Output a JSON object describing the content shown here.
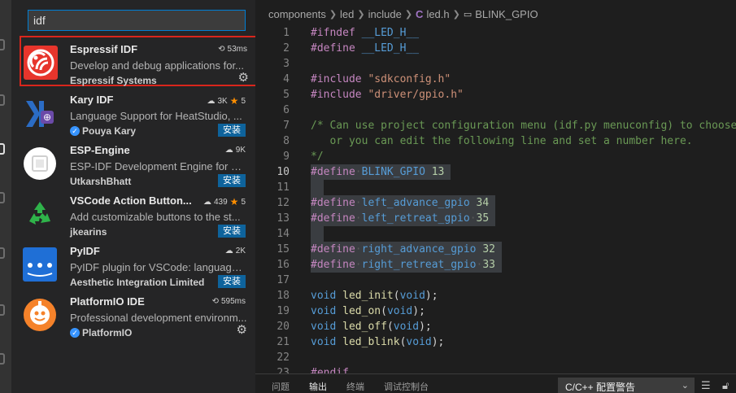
{
  "search": {
    "value": "idf"
  },
  "extensions": [
    {
      "name": "Espressif IDF",
      "description": "Develop and debug applications for...",
      "publisher": "Espressif Systems",
      "verified": false,
      "meta": "53ms",
      "meta_icon": "history-icon",
      "installed": true,
      "action": "gear",
      "selected": true
    },
    {
      "name": "Kary IDF",
      "description": "Language Support for HeatStudio, ...",
      "publisher": "Pouya Kary",
      "verified": true,
      "meta": "3K",
      "rating": "5",
      "installed": false,
      "action_label": "安装"
    },
    {
      "name": "ESP-Engine",
      "description": "ESP-IDF Development Engine for Mi...",
      "publisher": "UtkarshBhatt",
      "verified": false,
      "meta": "9K",
      "installed": false,
      "action_label": "安装"
    },
    {
      "name": "VSCode Action Button...",
      "description": "Add customizable buttons to the st...",
      "publisher": "jkearins",
      "verified": false,
      "meta": "439",
      "rating": "5",
      "installed": false,
      "action_label": "安装"
    },
    {
      "name": "PyIDF",
      "description": "PyIDF plugin for VSCode: language ...",
      "publisher": "Aesthetic Integration Limited",
      "verified": false,
      "meta": "2K",
      "installed": false,
      "action_label": "安装"
    },
    {
      "name": "PlatformIO IDE",
      "description": "Professional development environm...",
      "publisher": "PlatformIO",
      "verified": true,
      "meta": "595ms",
      "meta_icon": "history-icon",
      "installed": true,
      "action": "gear"
    }
  ],
  "breadcrumb": [
    "components",
    "led",
    "include",
    "led.h",
    "BLINK_GPIO"
  ],
  "code": {
    "line_numbers": [
      "1",
      "2",
      "3",
      "4",
      "5",
      "6",
      "7",
      "8",
      "9",
      "10",
      "11",
      "12",
      "13",
      "14",
      "15",
      "16",
      "17",
      "18",
      "19",
      "20",
      "21",
      "22",
      "23"
    ],
    "active_line": "10",
    "lines": {
      "l1_kw": "#ifndef",
      "l1_mac": "__LED_H__",
      "l2_kw": "#define",
      "l2_mac": "__LED_H__",
      "l4_kw": "#include",
      "l4_str": "\"sdkconfig.h\"",
      "l5_kw": "#include",
      "l5_str": "\"driver/gpio.h\"",
      "l7_cm": "/* Can use project configuration menu (idf.py menuconfig) to choose",
      "l8_cm": "   or you can edit the following line and set a number here.",
      "l9_cm": "*/",
      "l10_kw": "#define",
      "l10_mac": "BLINK_GPIO",
      "l10_num": "13",
      "l12_kw": "#define",
      "l12_mac": "left_advance_gpio",
      "l12_num": "34",
      "l13_kw": "#define",
      "l13_mac": "left_retreat_gpio",
      "l13_num": "35",
      "l15_kw": "#define",
      "l15_mac": "right_advance_gpio",
      "l15_num": "32",
      "l16_kw": "#define",
      "l16_mac": "right_retreat_gpio",
      "l16_num": "33",
      "l18_ty": "void",
      "l18_fn": "led_init",
      "l18_arg": "void",
      "l19_ty": "void",
      "l19_fn": "led_on",
      "l19_arg": "void",
      "l20_ty": "void",
      "l20_fn": "led_off",
      "l20_arg": "void",
      "l21_ty": "void",
      "l21_fn": "led_blink",
      "l21_arg": "void",
      "l23_kw": "#endif"
    }
  },
  "panel": {
    "tabs": [
      "问题",
      "输出",
      "终端",
      "调试控制台"
    ],
    "active_tab": "输出",
    "select_value": "C/C++ 配置警告"
  },
  "colors": {
    "accent": "#007fd4",
    "install_button": "#0e639c",
    "selection_outline": "#d9261c",
    "star": "#ff8e00"
  }
}
